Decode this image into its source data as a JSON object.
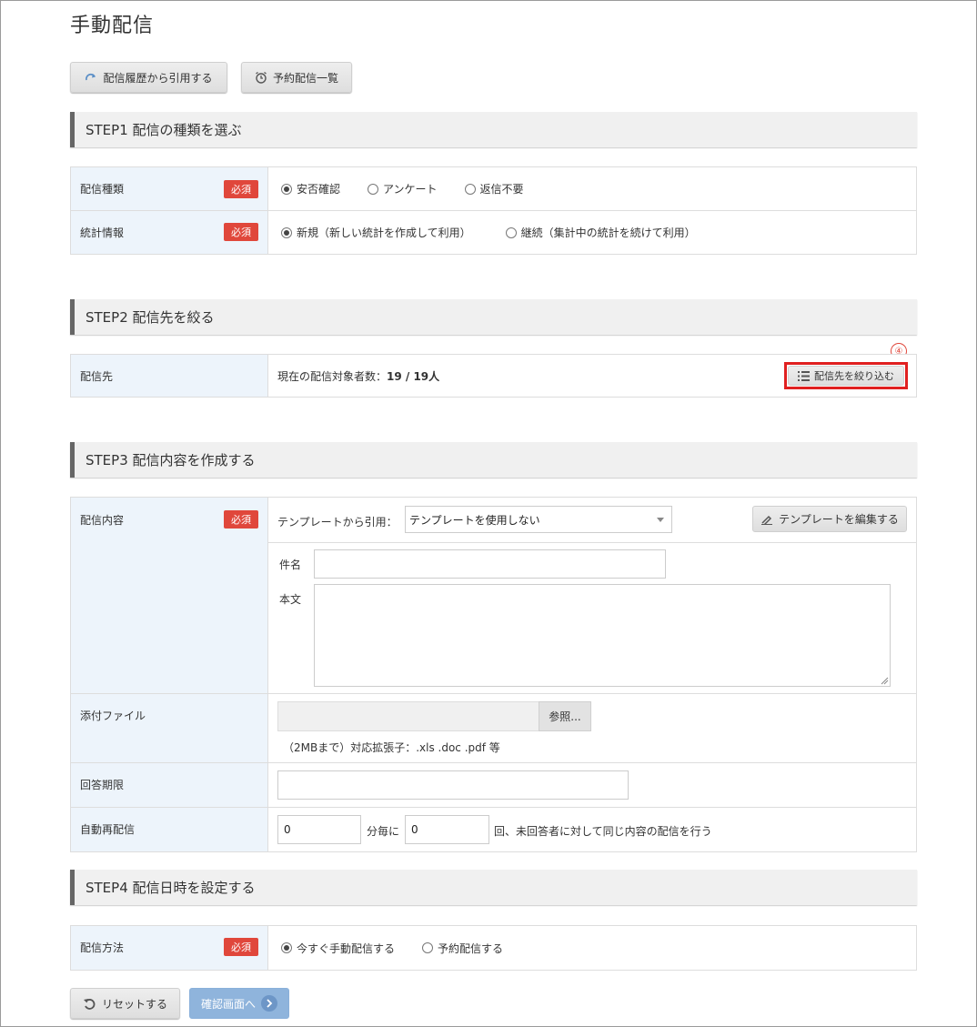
{
  "page": {
    "title": "手動配信"
  },
  "toolbar": {
    "history_label": "配信履歴から引用する",
    "scheduled_label": "予約配信一覧"
  },
  "steps": {
    "step1": "STEP1 配信の種類を選ぶ",
    "step2": "STEP2 配信先を絞る",
    "step3": "STEP3 配信内容を作成する",
    "step4": "STEP4 配信日時を設定する"
  },
  "required_label": "必須",
  "step1": {
    "type": {
      "label": "配信種類",
      "options": [
        "安否確認",
        "アンケート",
        "返信不要"
      ],
      "selected": "安否確認"
    },
    "stats": {
      "label": "統計情報",
      "options": [
        "新規（新しい統計を作成して利用）",
        "継続（集計中の統計を続けて利用）"
      ],
      "selected": "新規（新しい統計を作成して利用）"
    }
  },
  "step2": {
    "label": "配信先",
    "count_prefix": "現在の配信対象者数：",
    "count_value": "19 / 19人",
    "filter_button": "配信先を絞り込む",
    "annotation": "④"
  },
  "step3": {
    "content_label": "配信内容",
    "template_prefix": "テンプレートから引用：",
    "template_selected": "テンプレートを使用しない",
    "edit_template_button": "テンプレートを編集する",
    "subject_label": "件名",
    "subject_value": "",
    "body_label": "本文",
    "body_value": "",
    "attachment_label": "添付ファイル",
    "browse_button": "参照...",
    "attachment_note": "（2MBまで）対応拡張子：.xls .doc .pdf 等",
    "deadline_label": "回答期限",
    "deadline_value": "",
    "resend_label": "自動再配信",
    "resend_interval": "0",
    "resend_interval_suffix": "分毎に",
    "resend_count": "0",
    "resend_suffix": "回、未回答者に対して同じ内容の配信を行う"
  },
  "step4": {
    "method_label": "配信方法",
    "options": [
      "今すぐ手動配信する",
      "予約配信する"
    ],
    "selected": "今すぐ手動配信する"
  },
  "footer": {
    "reset_label": "リセットする",
    "confirm_label": "確認画面へ"
  },
  "colors": {
    "required": "#e0473b",
    "label_bg": "#edf4fb",
    "confirm": "#8fb4dc",
    "highlight": "#e02020"
  }
}
